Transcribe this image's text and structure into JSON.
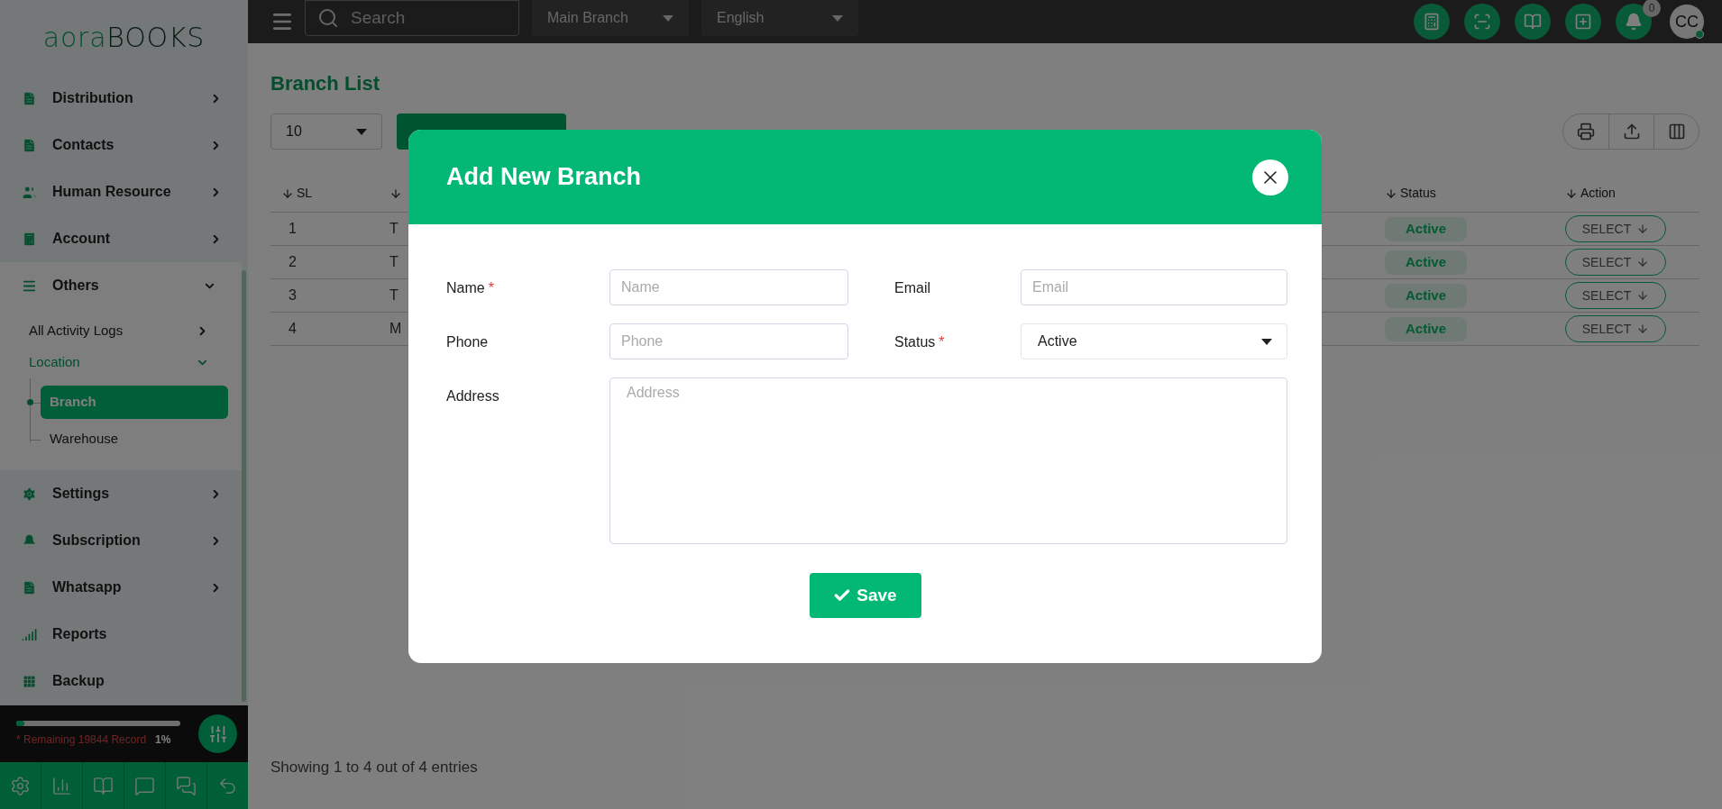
{
  "logo": {
    "part_1": "aora",
    "part_2": "BOOKS"
  },
  "sidebar": {
    "items": [
      {
        "label": "Distribution",
        "kind": "group",
        "expanded": false
      },
      {
        "label": "Contacts",
        "kind": "group",
        "expanded": false
      },
      {
        "label": "Human Resource",
        "kind": "group",
        "expanded": false
      },
      {
        "label": "Account",
        "kind": "group",
        "expanded": false
      },
      {
        "label": "Others",
        "kind": "group",
        "expanded": true,
        "children": [
          {
            "label": "All Activity Logs",
            "kind": "group",
            "expanded": false
          },
          {
            "label": "Location",
            "kind": "group",
            "expanded": true,
            "children": [
              {
                "label": "Branch",
                "selected": true
              },
              {
                "label": "Warehouse",
                "selected": false
              }
            ]
          }
        ]
      },
      {
        "label": "Settings",
        "kind": "group",
        "expanded": false
      },
      {
        "label": "Subscription",
        "kind": "group",
        "expanded": false
      },
      {
        "label": "Whatsapp",
        "kind": "group",
        "expanded": false
      },
      {
        "label": "Reports",
        "kind": "link"
      },
      {
        "label": "Backup",
        "kind": "link"
      }
    ]
  },
  "usage": {
    "level": 0.05,
    "note": "* Remaining 19844 Record",
    "reading": "1%"
  },
  "topbar": {
    "search": {
      "placeholder": "Search"
    },
    "branch_select": "Main Branch",
    "language_select": "English",
    "notification_count": "0",
    "avatar": "CC"
  },
  "page": {
    "title": "Branch List",
    "page_size": "10",
    "table": {
      "columns": {
        "sl": "SL",
        "status": "Status",
        "action": "Action"
      },
      "rows": [
        {
          "sl": "1",
          "column_2": "T",
          "status": "Active",
          "action": "SELECT"
        },
        {
          "sl": "2",
          "column_2": "T",
          "status": "Active",
          "action": "SELECT"
        },
        {
          "sl": "3",
          "column_2": "T",
          "status": "Active",
          "action": "SELECT"
        },
        {
          "sl": "4",
          "column_2": "M",
          "status": "Active",
          "action": "SELECT"
        }
      ]
    },
    "footer": "Showing 1 to 4 out of 4 entries"
  },
  "modal": {
    "title": "Add New Branch",
    "fields": [
      {
        "label": "Name",
        "required_mark": "*",
        "kind": "input",
        "placeholder": "Name"
      },
      {
        "label": "Email",
        "kind": "input",
        "placeholder": "Email"
      },
      {
        "label": "Phone",
        "kind": "input",
        "placeholder": "Phone"
      },
      {
        "label": "Status",
        "required_mark": "*",
        "kind": "select",
        "value": "Active"
      },
      {
        "label": "Address",
        "kind": "textarea",
        "placeholder": "Address"
      }
    ],
    "save": "Save"
  }
}
